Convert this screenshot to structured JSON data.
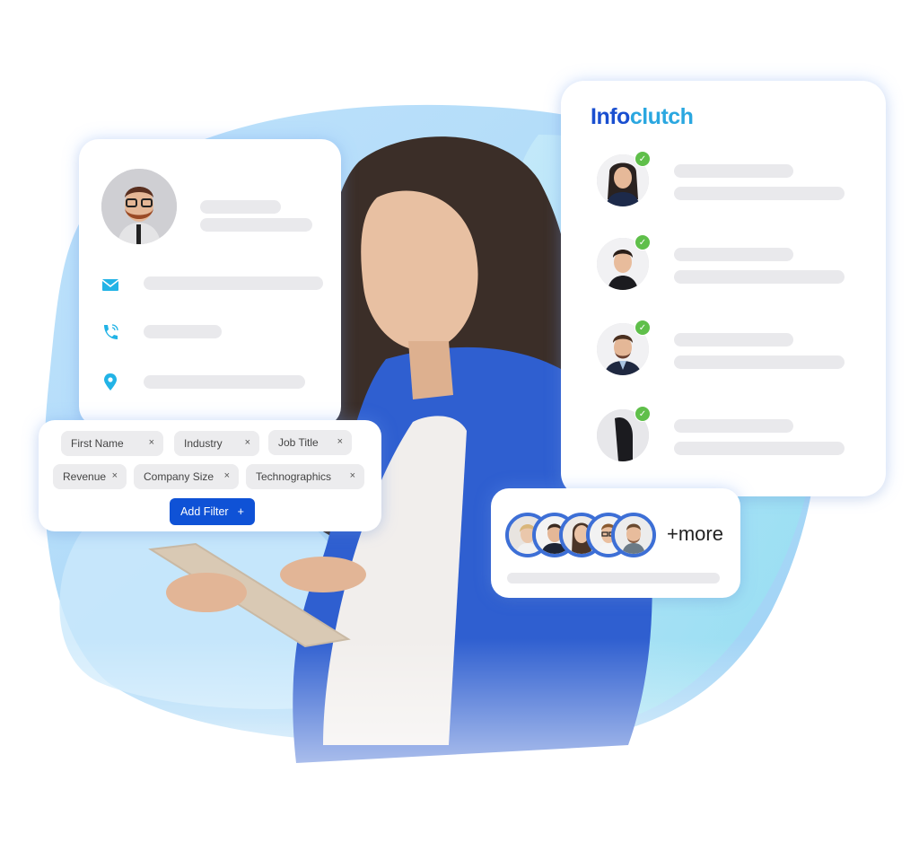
{
  "brand": {
    "name_part1": "Info",
    "name_part2": "clutch",
    "primary_color": "#1a4fd0",
    "accent_color": "#2aa7e0",
    "button_color": "#0f52d6",
    "check_color": "#5fbf4a"
  },
  "profile_card": {
    "avatar": "bearded-man-glasses-photo",
    "fields": [
      {
        "icon": "envelope-icon"
      },
      {
        "icon": "phone-icon"
      },
      {
        "icon": "location-pin-icon"
      }
    ]
  },
  "filter_card": {
    "chips": [
      {
        "label": "First Name",
        "remove": "×"
      },
      {
        "label": "Industry",
        "remove": "×"
      },
      {
        "label": "Job Title",
        "remove": "×"
      },
      {
        "label": "Revenue",
        "remove": "×"
      },
      {
        "label": "Company Size",
        "remove": "×"
      },
      {
        "label": "Technographics",
        "remove": "×"
      }
    ],
    "add_button": {
      "label": "Add Filter",
      "icon": "+"
    }
  },
  "contacts_card": {
    "contacts": [
      {
        "avatar": "woman-photo",
        "verified": true
      },
      {
        "avatar": "man-photo",
        "verified": true
      },
      {
        "avatar": "bearded-man-photo",
        "verified": true
      },
      {
        "avatar": "person-photo",
        "verified": true
      }
    ]
  },
  "more_card": {
    "avatars": [
      "woman-glasses-photo",
      "man-suit-photo",
      "woman-photo",
      "man-glasses-photo",
      "bearded-man-photo"
    ],
    "more_label": "+more"
  },
  "check_glyph": "✓"
}
